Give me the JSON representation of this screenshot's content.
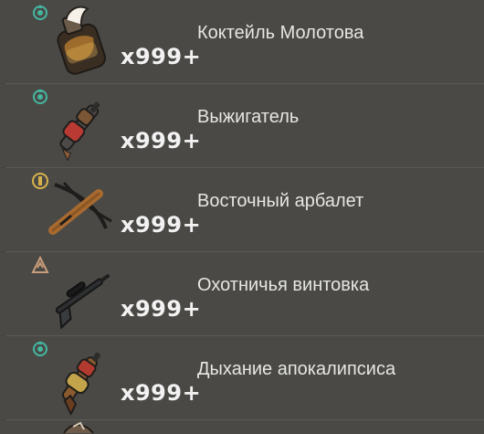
{
  "items": [
    {
      "name": "Коктейль Молотова",
      "qty": "x999+",
      "icon": "molotov-cocktail-icon",
      "badge": "teal-rank-badge-icon"
    },
    {
      "name": "Выжигатель",
      "qty": "x999+",
      "icon": "flamethrower-icon",
      "badge": "teal-rank-badge-icon"
    },
    {
      "name": "Восточный арбалет",
      "qty": "x999+",
      "icon": "crossbow-icon",
      "badge": "gold-rank-badge-icon"
    },
    {
      "name": "Охотничья винтовка",
      "qty": "x999+",
      "icon": "hunting-rifle-icon",
      "badge": "bronze-rank-badge-icon"
    },
    {
      "name": "Дыхание апокалипсиса",
      "qty": "x999+",
      "icon": "apocalypse-gun-icon",
      "badge": "teal-rank-badge-icon"
    }
  ],
  "colors": {
    "background": "#464542",
    "teal_badge": "#43b7a0",
    "gold_badge": "#d7b24b",
    "bronze_badge": "#c99c7a"
  }
}
